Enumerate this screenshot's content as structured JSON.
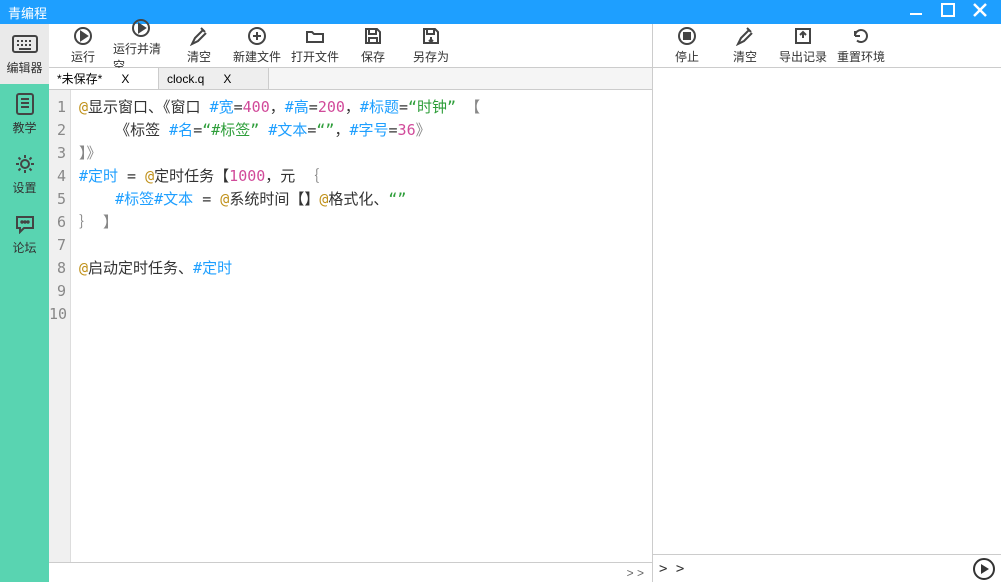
{
  "title": "青编程",
  "sidebar": {
    "items": [
      {
        "label": "编辑器"
      },
      {
        "label": "教学"
      },
      {
        "label": "设置"
      },
      {
        "label": "论坛"
      }
    ]
  },
  "toolbars": {
    "left": [
      {
        "label": "运行"
      },
      {
        "label": "运行并清空"
      },
      {
        "label": "清空"
      },
      {
        "label": "新建文件"
      },
      {
        "label": "打开文件"
      },
      {
        "label": "保存"
      },
      {
        "label": "另存为"
      }
    ],
    "right": [
      {
        "label": "停止"
      },
      {
        "label": "清空"
      },
      {
        "label": "导出记录"
      },
      {
        "label": "重置环境"
      }
    ]
  },
  "tabs": [
    {
      "label": "*未保存*"
    },
    {
      "label": "clock.q"
    }
  ],
  "editor": {
    "lines": [
      "1",
      "2",
      "3",
      "4",
      "5",
      "6",
      "7",
      "8",
      "9",
      "10"
    ]
  },
  "code": {
    "l1a": "@",
    "l1b": "显示窗口、《窗口 ",
    "l1c": "#宽",
    "l1d": "=",
    "l1e": "400",
    "l1f": "，",
    "l1g": "#高",
    "l1h": "=",
    "l1i": "200",
    "l1j": "，",
    "l1k": "#标题",
    "l1l": "=",
    "l1m": "“时钟”",
    "l1n": " 【",
    "l2a": "    《标签 ",
    "l2b": "#名",
    "l2c": "=",
    "l2d": "“#标签”",
    "l2e": " ",
    "l2f": "#文本",
    "l2g": "=",
    "l2h": "“”",
    "l2i": "，",
    "l2j": "#字号",
    "l2k": "=",
    "l2l": "36",
    "l2m": "》",
    "l3": "】》",
    "l4a": "#定时",
    "l4b": " = ",
    "l4c": "@",
    "l4d": "定时任务【",
    "l4e": "1000",
    "l4f": "，元 ",
    "l4g": "｛",
    "l5a": "    ",
    "l5b": "#标签#文本",
    "l5c": " = ",
    "l5d": "@",
    "l5e": "系统时间【】",
    "l5f": "@",
    "l5g": "格式化、",
    "l5h": "“”",
    "l6": "｝ 】",
    "l8a": "@",
    "l8b": "启动定时任务、",
    "l8c": "#定时"
  },
  "footer": {
    "chev": "> >"
  },
  "prompt": "> >"
}
